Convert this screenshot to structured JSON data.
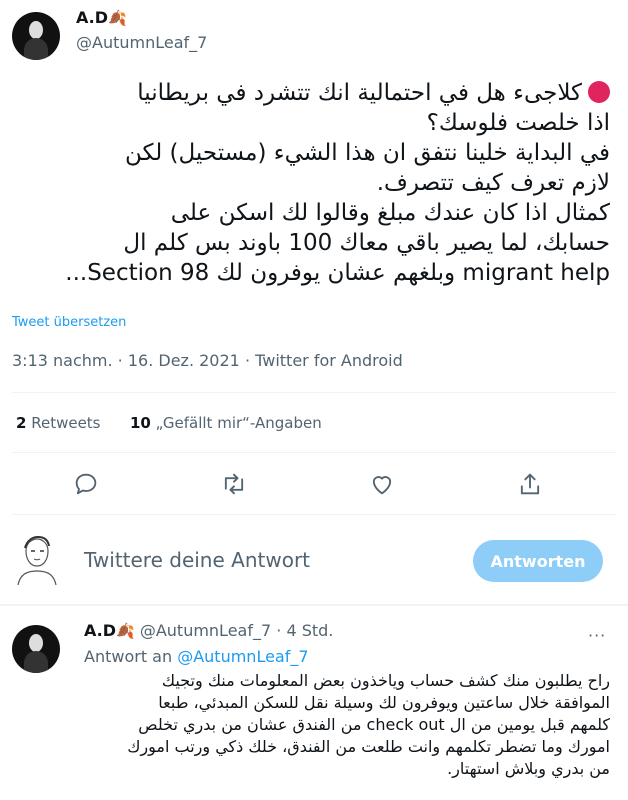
{
  "tweet": {
    "author_name": "A.D",
    "author_emoji": "🍂",
    "author_handle": "@AutumnLeaf_7",
    "lines": [
      "كلاجىء هل في احتمالية انك تتشرد في بريطانيا",
      "اذا خلصت فلوسك؟",
      "في البداية خلينا نتفق ان هذا الشيء (مستحيل) لكن",
      "لازم تعرف كيف تتصرف.",
      "كمثال اذا كان عندك مبلغ وقالوا لك اسكن على",
      "حسابك، لما يصير باقي معاك 100 باوند بس كلم ال",
      "migrant help وبلغهم عشان يوفرون لك Section 98..."
    ],
    "translate_label": "Tweet übersetzen",
    "time": "3:13 nachm.",
    "sep": "·",
    "date": "16. Dez. 2021",
    "source": "Twitter for Android",
    "retweets_count": "2",
    "retweets_label": "Retweets",
    "likes_count": "10",
    "likes_label": "„Gefällt mir“-Angaben"
  },
  "actions": {
    "icons": [
      "reply-icon",
      "retweet-icon",
      "like-icon",
      "share-icon"
    ]
  },
  "compose": {
    "placeholder": "Twittere deine Antwort",
    "button_label": "Antworten"
  },
  "reply": {
    "author_name": "A.D",
    "author_emoji": "🍂",
    "author_handle": "@AutumnLeaf_7",
    "time_sep": "·",
    "time_ago": "4 Std.",
    "replying_to_label": "Antwort an",
    "replying_to_handle": "@AutumnLeaf_7",
    "more_label": "···",
    "lines": [
      "راح يطلبون منك كشف حساب وياخذون بعض المعلومات منك وتجيك",
      "الموافقة خلال ساعتين ويوفرون لك وسيلة نقل للسكن المبدئي، طبعا",
      "كلمهم قبل يومين من ال check out من الفندق عشان من بدري تخلص",
      "امورك وما تضطر تكلمهم وانت طلعت من الفندق، خلك ذكي ورتب امورك",
      "من بدري وبلاش استهتار."
    ]
  },
  "colors": {
    "accent": "#1d9bf0",
    "button_disabled": "#8ecdf8",
    "muted": "#536471",
    "red_dot": "#e0245e"
  }
}
